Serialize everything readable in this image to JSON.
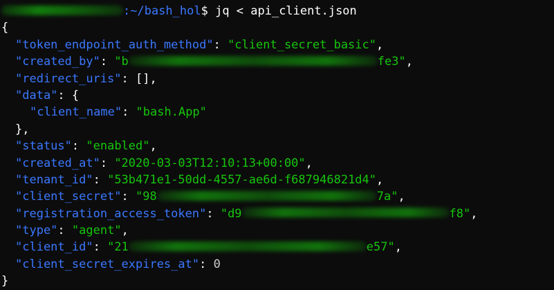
{
  "prompt": {
    "path": ":~/bash_hol",
    "symbol": "$",
    "command": " jq < api_client.json"
  },
  "json": {
    "open_brace": "{",
    "close_brace": "}",
    "entries": {
      "token_endpoint_auth_method": {
        "key": "\"token_endpoint_auth_method\"",
        "value": "\"client_secret_basic\""
      },
      "created_by": {
        "key": "\"created_by\"",
        "value_start": "\"b",
        "value_end": "fe3\""
      },
      "redirect_uris": {
        "key": "\"redirect_uris\"",
        "value": "[]"
      },
      "data": {
        "key": "\"data\"",
        "open": "{",
        "close": "},"
      },
      "client_name": {
        "key": "\"client_name\"",
        "value": "\"bash.App\""
      },
      "status": {
        "key": "\"status\"",
        "value": "\"enabled\""
      },
      "created_at": {
        "key": "\"created_at\"",
        "value": "\"2020-03-03T12:10:13+00:00\""
      },
      "tenant_id": {
        "key": "\"tenant_id\"",
        "value": "\"53b471e1-50dd-4557-ae6d-f687946821d4\""
      },
      "client_secret": {
        "key": "\"client_secret\"",
        "value_start": "\"98",
        "value_end": "7a\""
      },
      "registration_access_token": {
        "key": "\"registration_access_token\"",
        "value_start": "\"d9",
        "value_end": "f8\""
      },
      "type": {
        "key": "\"type\"",
        "value": "\"agent\""
      },
      "client_id": {
        "key": "\"client_id\"",
        "value_start": "\"21",
        "value_end": "e57\""
      },
      "client_secret_expires_at": {
        "key": "\"client_secret_expires_at\"",
        "value": "0"
      }
    }
  },
  "colors": {
    "background": "#0c0c0c",
    "key": "#3b78ff",
    "string": "#16c60c",
    "punctuation": "#ffffff",
    "number": "#cccccc"
  }
}
